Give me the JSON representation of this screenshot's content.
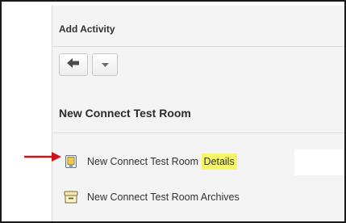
{
  "header": {
    "title": "Add Activity"
  },
  "toolbar": {
    "back_icon": "arrow-left-icon",
    "dropdown_icon": "caret-down-icon"
  },
  "section": {
    "title": "New Connect Test Room"
  },
  "items": [
    {
      "icon": "meeting-room-icon",
      "label_prefix": "New Connect Test Room ",
      "label_highlight": "Details"
    },
    {
      "icon": "archive-box-icon",
      "label": "New Connect Test Room Archives"
    }
  ],
  "annotation": {
    "arrow_color": "#d0121b",
    "highlight_color": "#f7f56a"
  }
}
